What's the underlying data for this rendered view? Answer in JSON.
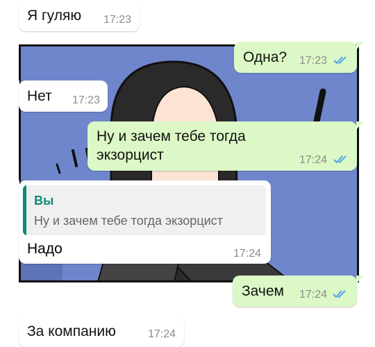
{
  "messages": [
    {
      "text": "Я гуляю",
      "time": "17:23"
    },
    {
      "text": "Одна?",
      "time": "17:23"
    },
    {
      "text": "Нет",
      "time": "17:23"
    },
    {
      "text_line1": "Ну и зачем тебе тогда",
      "text_line2": "экзорцист",
      "time": "17:24"
    },
    {
      "quote_author": "Вы",
      "quote_text": "Ну и зачем тебе тогда экзорцист",
      "text": "Надо",
      "time": "17:24"
    },
    {
      "text": "Зачем",
      "time": "17:24"
    },
    {
      "text": "За компанию",
      "time": "17:24"
    }
  ],
  "colors": {
    "incoming": "#ffffff",
    "outgoing": "#dcf8c6",
    "read_ticks": "#4fa4e8",
    "quote_accent": "#0c8a75",
    "panel_background": "#6f86cc"
  },
  "icons": {
    "read_receipt": "double-check-icon"
  }
}
